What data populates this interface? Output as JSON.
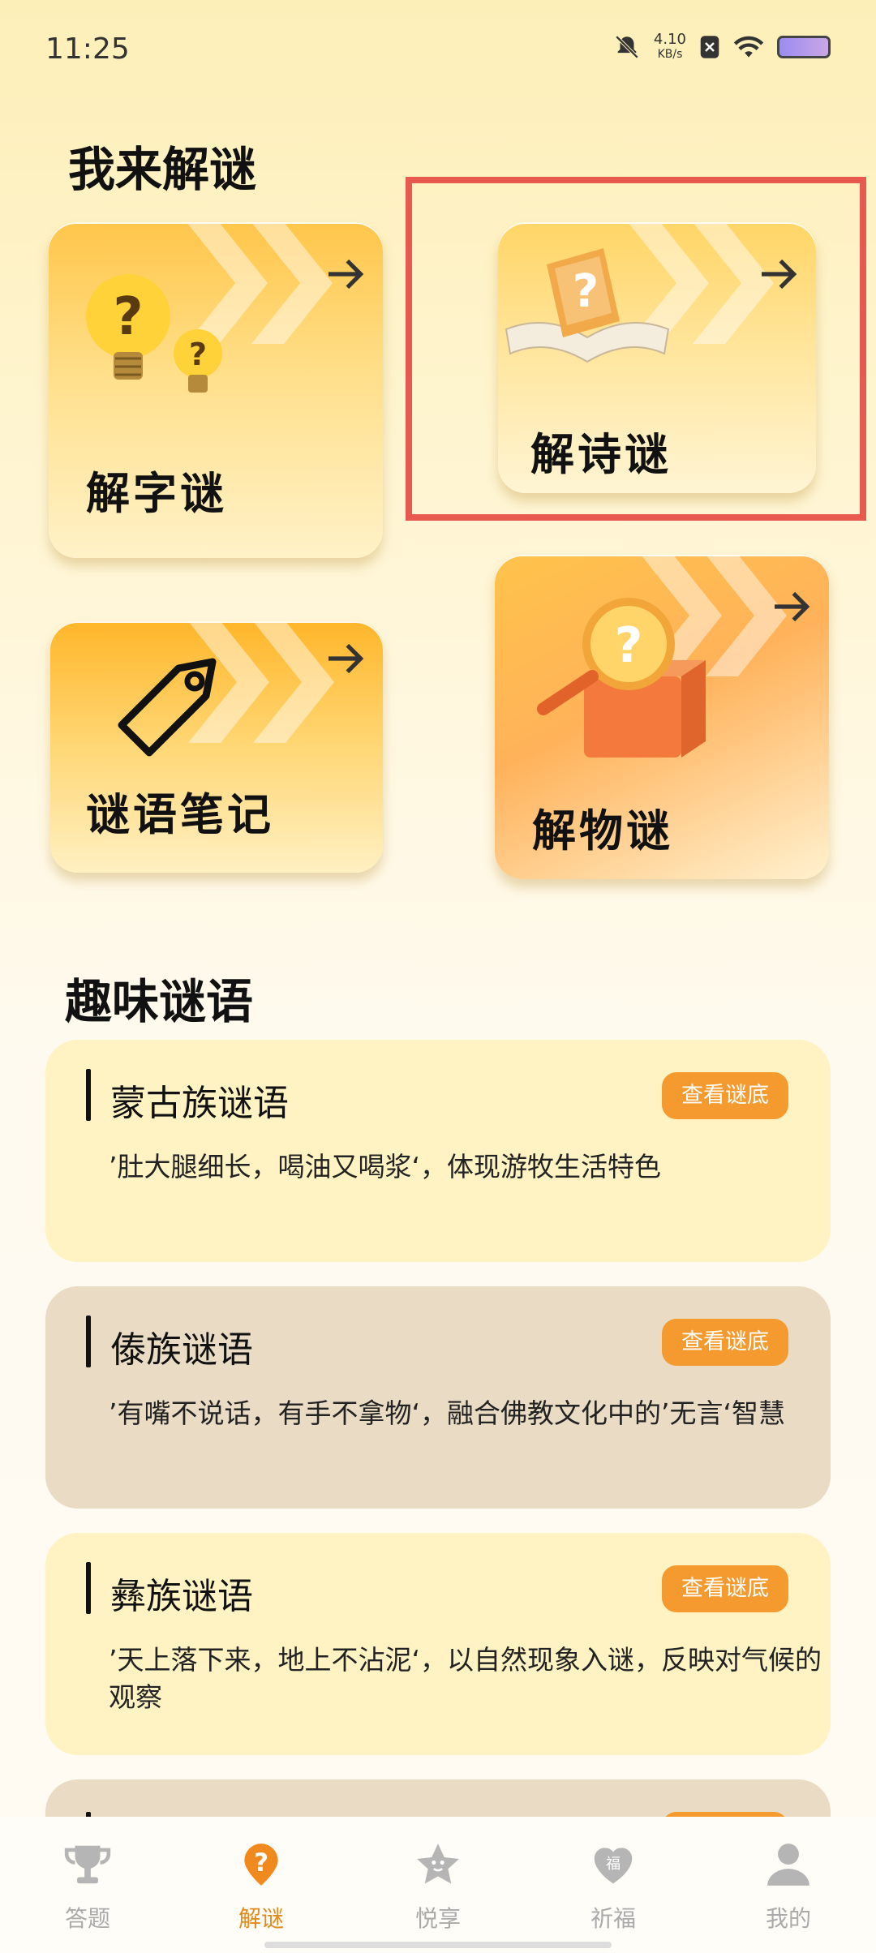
{
  "status": {
    "time": "11:25",
    "net_speed_value": "4.10",
    "net_speed_unit": "KB/s",
    "icons": [
      "bell-muted-icon",
      "sim-none-icon",
      "wifi-icon",
      "battery-icon"
    ]
  },
  "section1": {
    "title": "我来解谜",
    "cards": {
      "char": "解字谜",
      "poem": "解诗谜",
      "notes": "谜语笔记",
      "object": "解物谜"
    }
  },
  "section2": {
    "title": "趣味谜语",
    "items": [
      {
        "title": "蒙古族谜语",
        "button": "查看谜底",
        "desc": "’肚大腿细长，喝油又喝浆‘，体现游牧生活特色"
      },
      {
        "title": "傣族谜语",
        "button": "查看谜底",
        "desc": "’有嘴不说话，有手不拿物‘，融合佛教文化中的’无言‘智慧"
      },
      {
        "title": "彝族谜语",
        "button": "查看谜底",
        "desc": "’天上落下来，地上不沾泥‘，以自然现象入谜，反映对气候的观察"
      }
    ]
  },
  "tabbar": {
    "items": [
      "答题",
      "解谜",
      "悦享",
      "祈福",
      "我的"
    ],
    "active": "解谜",
    "bless_char": "福"
  },
  "colors": {
    "accent": "#f59a2e",
    "active_tab": "#e38a1f",
    "highlight_border": "#e85a4f",
    "card_light": "#fff3c4",
    "card_dark": "#eadbc4"
  }
}
